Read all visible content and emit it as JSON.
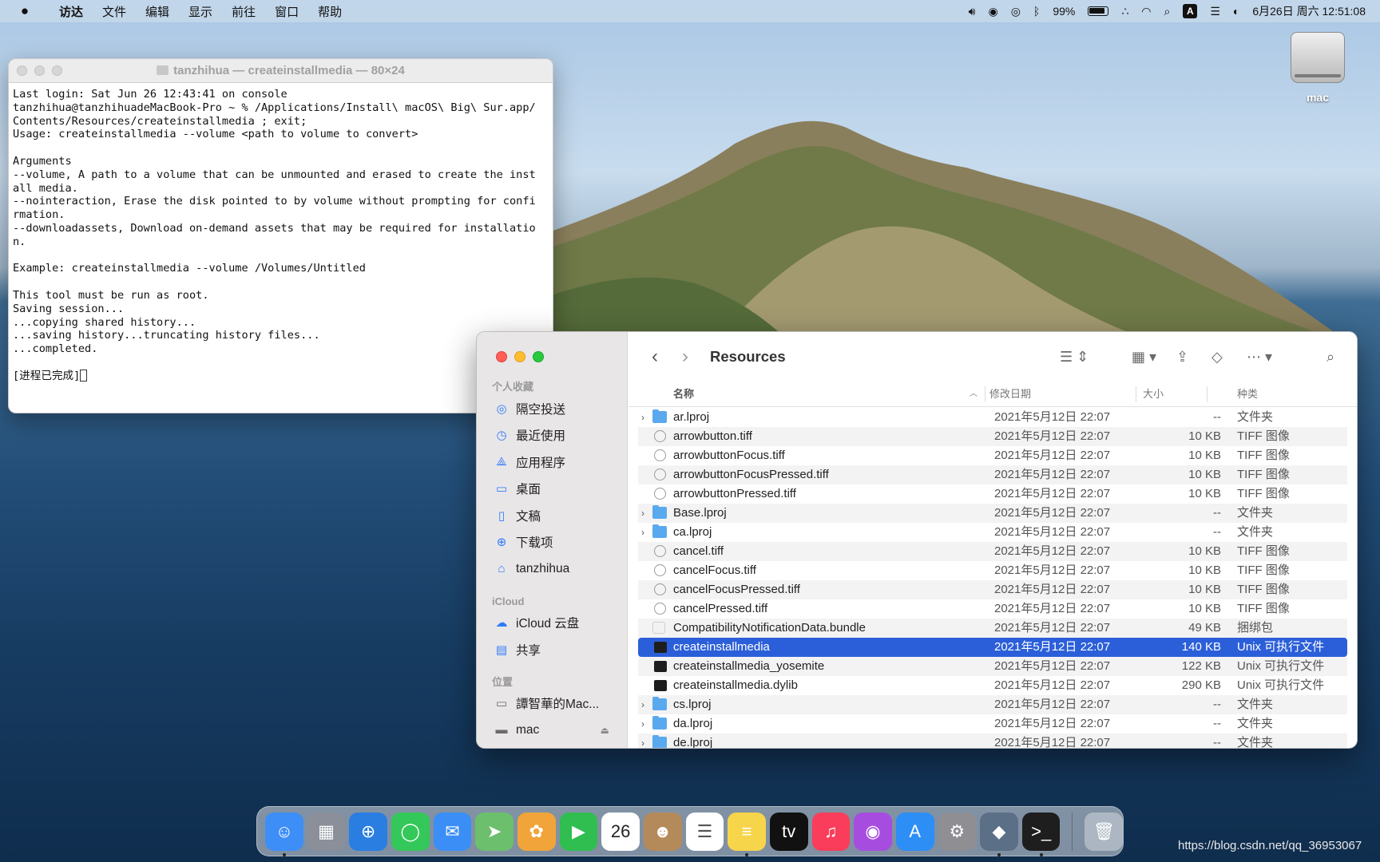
{
  "menubar": {
    "apple": "",
    "items": [
      "访达",
      "文件",
      "编辑",
      "显示",
      "前往",
      "窗口",
      "帮助"
    ],
    "battery": "99%",
    "datetime": "6月26日 周六  12:51:08",
    "input_source": "A"
  },
  "desktop": {
    "disk_label": "mac"
  },
  "terminal": {
    "title": "tanzhihua — createinstallmedia — 80×24",
    "lines": [
      "Last login: Sat Jun 26 12:43:41 on console",
      "tanzhihua@tanzhihuadeMacBook-Pro ~ % /Applications/Install\\ macOS\\ Big\\ Sur.app/",
      "Contents/Resources/createinstallmedia ; exit;",
      "Usage: createinstallmedia --volume <path to volume to convert>",
      "",
      "Arguments",
      "--volume, A path to a volume that can be unmounted and erased to create the inst",
      "all media.",
      "--nointeraction, Erase the disk pointed to by volume without prompting for confi",
      "rmation.",
      "--downloadassets, Download on-demand assets that may be required for installatio",
      "n.",
      "",
      "Example: createinstallmedia --volume /Volumes/Untitled",
      "",
      "This tool must be run as root.",
      "Saving session...",
      "...copying shared history...",
      "...saving history...truncating history files...",
      "...completed.",
      "",
      "[进程已完成]"
    ]
  },
  "finder": {
    "title": "Resources",
    "sidebar": {
      "favorites_header": "个人收藏",
      "favorites": [
        {
          "label": "隔空投送",
          "icon": "airdrop-icon"
        },
        {
          "label": "最近使用",
          "icon": "clock-icon"
        },
        {
          "label": "应用程序",
          "icon": "applications-icon"
        },
        {
          "label": "桌面",
          "icon": "desktop-icon"
        },
        {
          "label": "文稿",
          "icon": "document-icon"
        },
        {
          "label": "下载项",
          "icon": "download-icon"
        },
        {
          "label": "tanzhihua",
          "icon": "home-icon"
        }
      ],
      "icloud_header": "iCloud",
      "icloud": [
        {
          "label": "iCloud 云盘",
          "icon": "cloud-icon"
        },
        {
          "label": "共享",
          "icon": "shared-folder-icon"
        }
      ],
      "locations_header": "位置",
      "locations": [
        {
          "label": "譚智華的Mac...",
          "icon": "laptop-icon"
        },
        {
          "label": "mac",
          "icon": "drive-icon"
        }
      ]
    },
    "columns": {
      "name": "名称",
      "modified": "修改日期",
      "size": "大小",
      "kind": "种类"
    },
    "rows": [
      {
        "name": "ar.lproj",
        "date": "2021年5月12日 22:07",
        "size": "--",
        "kind": "文件夹",
        "type": "folder"
      },
      {
        "name": "arrowbutton.tiff",
        "date": "2021年5月12日 22:07",
        "size": "10 KB",
        "kind": "TIFF 图像",
        "type": "tiff"
      },
      {
        "name": "arrowbuttonFocus.tiff",
        "date": "2021年5月12日 22:07",
        "size": "10 KB",
        "kind": "TIFF 图像",
        "type": "tiff"
      },
      {
        "name": "arrowbuttonFocusPressed.tiff",
        "date": "2021年5月12日 22:07",
        "size": "10 KB",
        "kind": "TIFF 图像",
        "type": "tiff"
      },
      {
        "name": "arrowbuttonPressed.tiff",
        "date": "2021年5月12日 22:07",
        "size": "10 KB",
        "kind": "TIFF 图像",
        "type": "tiff"
      },
      {
        "name": "Base.lproj",
        "date": "2021年5月12日 22:07",
        "size": "--",
        "kind": "文件夹",
        "type": "folder"
      },
      {
        "name": "ca.lproj",
        "date": "2021年5月12日 22:07",
        "size": "--",
        "kind": "文件夹",
        "type": "folder"
      },
      {
        "name": "cancel.tiff",
        "date": "2021年5月12日 22:07",
        "size": "10 KB",
        "kind": "TIFF 图像",
        "type": "tiff"
      },
      {
        "name": "cancelFocus.tiff",
        "date": "2021年5月12日 22:07",
        "size": "10 KB",
        "kind": "TIFF 图像",
        "type": "tiff"
      },
      {
        "name": "cancelFocusPressed.tiff",
        "date": "2021年5月12日 22:07",
        "size": "10 KB",
        "kind": "TIFF 图像",
        "type": "tiff"
      },
      {
        "name": "cancelPressed.tiff",
        "date": "2021年5月12日 22:07",
        "size": "10 KB",
        "kind": "TIFF 图像",
        "type": "tiff"
      },
      {
        "name": "CompatibilityNotificationData.bundle",
        "date": "2021年5月12日 22:07",
        "size": "49 KB",
        "kind": "捆绑包",
        "type": "bundle"
      },
      {
        "name": "createinstallmedia",
        "date": "2021年5月12日 22:07",
        "size": "140 KB",
        "kind": "Unix 可执行文件",
        "type": "exec",
        "selected": true
      },
      {
        "name": "createinstallmedia_yosemite",
        "date": "2021年5月12日 22:07",
        "size": "122 KB",
        "kind": "Unix 可执行文件",
        "type": "exec"
      },
      {
        "name": "createinstallmedia.dylib",
        "date": "2021年5月12日 22:07",
        "size": "290 KB",
        "kind": "Unix 可执行文件",
        "type": "exec"
      },
      {
        "name": "cs.lproj",
        "date": "2021年5月12日 22:07",
        "size": "--",
        "kind": "文件夹",
        "type": "folder"
      },
      {
        "name": "da.lproj",
        "date": "2021年5月12日 22:07",
        "size": "--",
        "kind": "文件夹",
        "type": "folder"
      },
      {
        "name": "de.lproj",
        "date": "2021年5月12日 22:07",
        "size": "--",
        "kind": "文件夹",
        "type": "folder"
      }
    ]
  },
  "dock": {
    "apps": [
      {
        "name": "finder",
        "color": "#3e8ef7",
        "glyph": "☺",
        "running": true
      },
      {
        "name": "launchpad",
        "color": "#8a8f99",
        "glyph": "▦"
      },
      {
        "name": "safari",
        "color": "#2a7de1",
        "glyph": "⊕"
      },
      {
        "name": "messages",
        "color": "#34c759",
        "glyph": "◯"
      },
      {
        "name": "mail",
        "color": "#3a8ef6",
        "glyph": "✉"
      },
      {
        "name": "maps",
        "color": "#6cbf6c",
        "glyph": "➤"
      },
      {
        "name": "photos",
        "color": "#f0a43a",
        "glyph": "✿"
      },
      {
        "name": "facetime",
        "color": "#2fbe4f",
        "glyph": "▶"
      },
      {
        "name": "calendar",
        "color": "#ffffff",
        "glyph": "26",
        "text_color": "#222"
      },
      {
        "name": "contacts",
        "color": "#b48a5a",
        "glyph": "☻"
      },
      {
        "name": "reminders",
        "color": "#ffffff",
        "glyph": "☰",
        "text_color": "#555"
      },
      {
        "name": "notes",
        "color": "#f7d54a",
        "glyph": "≡",
        "running": true
      },
      {
        "name": "tv",
        "color": "#111111",
        "glyph": "tv"
      },
      {
        "name": "music",
        "color": "#fa3d5a",
        "glyph": "♫"
      },
      {
        "name": "podcasts",
        "color": "#a64de0",
        "glyph": "◉"
      },
      {
        "name": "app-store",
        "color": "#2d8ef6",
        "glyph": "A"
      },
      {
        "name": "system-preferences",
        "color": "#8e8e93",
        "glyph": "⚙"
      },
      {
        "name": "install-macos",
        "color": "#5b6f87",
        "glyph": "◆",
        "running": true
      },
      {
        "name": "terminal",
        "color": "#1e1e1e",
        "glyph": ">_",
        "running": true
      }
    ],
    "trash_glyph": "🗑"
  },
  "watermark": "https://blog.csdn.net/qq_36953067"
}
